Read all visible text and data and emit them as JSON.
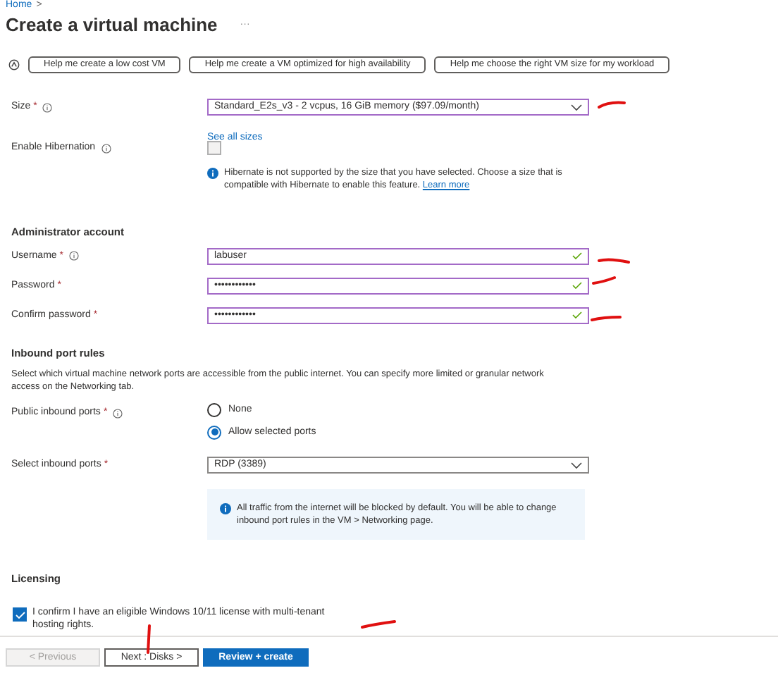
{
  "breadcrumb": [
    "Home",
    ">"
  ],
  "title": "Create a virtual machine",
  "more": "···",
  "helper_buttons": [
    "Help me create a low cost VM",
    "Help me create a VM optimized for high availability",
    "Help me choose the right VM size for my workload"
  ],
  "size": {
    "label": "Size",
    "required": "*",
    "info": true,
    "value": "Standard_E2s_v3 - 2 vcpus, 16 GiB memory ($97.09/month)",
    "link": "See all sizes"
  },
  "hibernation": {
    "label": "Enable Hibernation",
    "info": true,
    "checked": false,
    "disabled": true,
    "note": "Hibernate is not supported by the size that you have selected. Choose a size that is compatible with Hibernate to enable this feature.",
    "note_link": "Learn more"
  },
  "admin": {
    "heading": "Administrator account",
    "fields": [
      {
        "label": "Username",
        "required": "*",
        "info": true,
        "value": "labuser",
        "valid": true
      },
      {
        "label": "Password",
        "required": "*",
        "value": "••••••••••••",
        "valid": true
      },
      {
        "label": "Confirm password",
        "required": "*",
        "value": "••••••••••••",
        "valid": true
      }
    ]
  },
  "inbound": {
    "heading": "Inbound port rules",
    "description": "Select which virtual machine network ports are accessible from the public internet. You can specify more limited or granular network access on the Networking tab.",
    "public_label": "Public inbound ports",
    "public_required": "*",
    "public_info": true,
    "options": [
      {
        "label": "None",
        "selected": false
      },
      {
        "label": "Allow selected ports",
        "selected": true
      }
    ],
    "ports_label": "Select inbound ports",
    "ports_required": "*",
    "ports_value": "RDP (3389)",
    "note": "All traffic from the internet will be blocked by default. You will be able to change inbound port rules in the VM > Networking page."
  },
  "licensing": {
    "heading": "Licensing",
    "checked": true,
    "text": "I confirm I have an eligible Windows 10/11 license with multi-tenant hosting rights."
  },
  "footer": [
    {
      "label": "< Previous",
      "kind": "disabled"
    },
    {
      "label": "Next : Disks >",
      "kind": "secondary"
    },
    {
      "label": "Review + create",
      "kind": "primary"
    }
  ]
}
